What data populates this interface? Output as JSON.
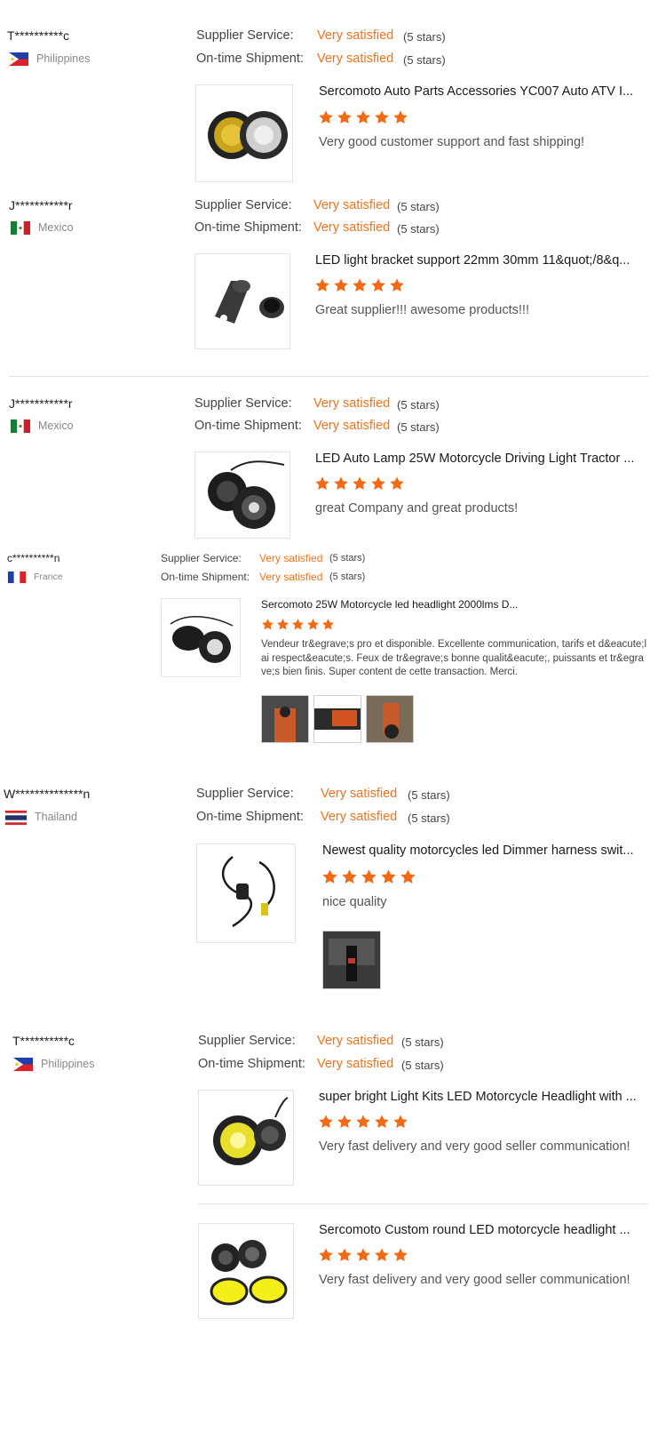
{
  "colors": {
    "accent": "#f0731b",
    "star": "#f26a16",
    "text": "#333333",
    "muted": "#888888"
  },
  "rating_labels": {
    "supplier": "Supplier Service:",
    "shipment": "On-time Shipment:"
  },
  "reviews": [
    {
      "buyer": "T**********c",
      "country": "Philippines",
      "flag": "philippines-flag-icon",
      "supplier_rating": "Very satisfied",
      "supplier_stars": "(5 stars)",
      "shipment_rating": "Very satisfied",
      "shipment_stars": "(5 stars)",
      "product": {
        "title": "Sercomoto Auto Parts Accessories YC007 Auto ATV I...",
        "stars": 5,
        "comment": "Very good customer support and fast shipping!"
      }
    },
    {
      "buyer": "J***********r",
      "country": "Mexico",
      "flag": "mexico-flag-icon",
      "supplier_rating": "Very satisfied",
      "supplier_stars": "(5 stars)",
      "shipment_rating": "Very satisfied",
      "shipment_stars": "(5 stars)",
      "product": {
        "title": "LED light bracket support 22mm 30mm 11&quot;/8&q...",
        "stars": 5,
        "comment": "Great supplier!!! awesome products!!!"
      }
    },
    {
      "buyer": "J***********r",
      "country": "Mexico",
      "flag": "mexico-flag-icon",
      "supplier_rating": "Very satisfied",
      "supplier_stars": "(5 stars)",
      "shipment_rating": "Very satisfied",
      "shipment_stars": "(5 stars)",
      "product": {
        "title": "LED Auto Lamp 25W Motorcycle Driving Light Tractor ...",
        "stars": 5,
        "comment": "great Company and great products!"
      }
    },
    {
      "buyer": "c**********n",
      "country": "France",
      "flag": "france-flag-icon",
      "supplier_rating": "Very satisfied",
      "supplier_stars": "(5 stars)",
      "shipment_rating": "Very satisfied",
      "shipment_stars": "(5 stars)",
      "product": {
        "title": "Sercomoto 25W Motorcycle led headlight 2000lms D...",
        "stars": 5,
        "comment": "Vendeur tr&egrave;s pro et disponible. Excellente communication, tarifs et d&eacute;lai respect&eacute;s. Feux de tr&egrave;s bonne qualit&eacute;, puissants et tr&egrave;s bien finis. Super content de cette transaction. Merci."
      }
    },
    {
      "buyer": "W**************n",
      "country": "Thailand",
      "flag": "thailand-flag-icon",
      "supplier_rating": "Very satisfied",
      "supplier_stars": "(5 stars)",
      "shipment_rating": "Very satisfied",
      "shipment_stars": "(5 stars)",
      "product": {
        "title": "Newest quality motorcycles led Dimmer harness swit...",
        "stars": 5,
        "comment": "nice quality"
      }
    },
    {
      "buyer": "T**********c",
      "country": "Philippines",
      "flag": "philippines-flag-icon",
      "supplier_rating": "Very satisfied",
      "supplier_stars": "(5 stars)",
      "shipment_rating": "Very satisfied",
      "shipment_stars": "(5 stars)",
      "products": [
        {
          "title": "super bright Light Kits LED Motorcycle Headlight with ...",
          "stars": 5,
          "comment": "Very fast delivery and very good seller communication!"
        },
        {
          "title": "Sercomoto Custom round LED motorcycle headlight ...",
          "stars": 5,
          "comment": "Very fast delivery and very good seller communication!"
        }
      ]
    }
  ]
}
